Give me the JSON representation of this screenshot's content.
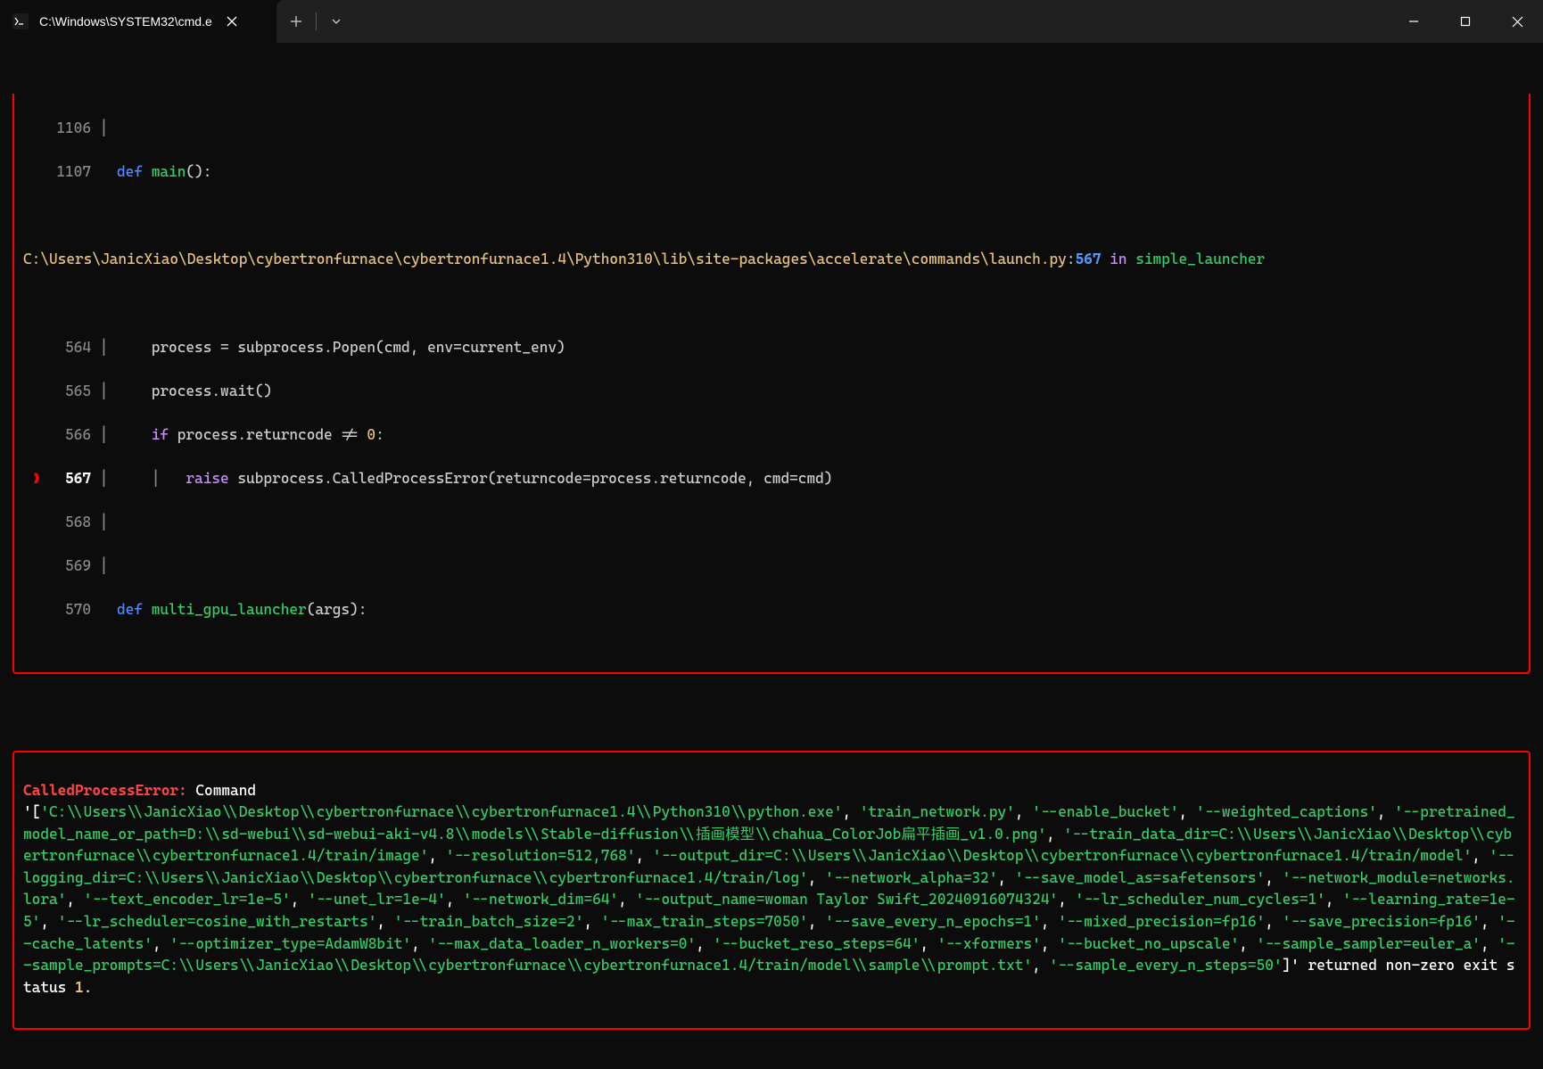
{
  "titlebar": {
    "tab_title": "C:\\Windows\\SYSTEM32\\cmd.e",
    "tab_icon": "cmd-icon",
    "close_icon": "×",
    "new_tab_icon": "+",
    "dropdown_icon": "⌄"
  },
  "window_controls": {
    "minimize": "—",
    "maximize": "□",
    "close": "✕"
  },
  "trace_top": {
    "ln1106": "1106",
    "ln1107": "1107",
    "ln1107_def": "def ",
    "ln1107_fn": "main",
    "ln1107_rest": "():",
    "path": "C:\\Users\\JanicXiao\\Desktop\\cybertronfurnace\\cybertronfurnace1.4\\Python310\\lib\\site-packages\\accelerate\\commands\\launch.py",
    "path_colon": ":",
    "path_line": "567",
    "path_in": " in ",
    "path_fn": "simple_launcher",
    "ln564": " 564",
    "ln564_code": "    process = subprocess.Popen(cmd, env=current_env)",
    "ln565": " 565",
    "ln565_code": "    process.wait()",
    "ln566": " 566",
    "ln566_if": "if",
    "ln566_cond": " process.returncode != ",
    "ln566_zero": "0",
    "ln566_colon": ":",
    "ln567": " 567",
    "ln567_raise": "raise",
    "ln567_rest": " subprocess.CalledProcessError(returncode=process.returncode, cmd=cmd)",
    "ln568": " 568",
    "ln569": " 569",
    "ln570": " 570",
    "ln570_def": "def ",
    "ln570_fn": "multi_gpu_launcher",
    "ln570_rest": "(args):",
    "marker": "❱"
  },
  "error": {
    "name": "CalledProcessError: ",
    "command_word": "Command",
    "open_bracket": "'[",
    "args": [
      "'C:\\\\Users\\\\JanicXiao\\\\Desktop\\\\cybertronfurnace\\\\cybertronfurnace1.4\\\\Python310\\\\python.exe'",
      "'train_network.py'",
      "'--enable_bucket'",
      "'--weighted_captions'",
      "'--pretrained_model_name_or_path=D:\\\\sd-webui\\\\sd-webui-aki-v4.8\\\\models\\\\Stable-diffusion\\\\插画模型\\\\chahua_ColorJob扁平插画_v1.0.png'",
      "'--train_data_dir=C:\\\\Users\\\\JanicXiao\\\\Desktop\\\\cybertronfurnace\\\\cybertronfurnace1.4/train/image'",
      "'--resolution=512,768'",
      "'--output_dir=C:\\\\Users\\\\JanicXiao\\\\Desktop\\\\cybertronfurnace\\\\cybertronfurnace1.4/train/model'",
      "'--logging_dir=C:\\\\Users\\\\JanicXiao\\\\Desktop\\\\cybertronfurnace\\\\cybertronfurnace1.4/train/log'",
      "'--network_alpha=32'",
      "'--save_model_as=safetensors'",
      "'--network_module=networks.lora'",
      "'--text_encoder_lr=1e-5'",
      "'--unet_lr=1e-4'",
      "'--network_dim=64'",
      "'--output_name=woman Taylor Swift_20240916074324'",
      "'--lr_scheduler_num_cycles=1'",
      "'--learning_rate=1e-5'",
      "'--lr_scheduler=cosine_with_restarts'",
      "'--train_batch_size=2'",
      "'--max_train_steps=7050'",
      "'--save_every_n_epochs=1'",
      "'--mixed_precision=fp16'",
      "'--save_precision=fp16'",
      "'--cache_latents'",
      "'--optimizer_type=AdamW8bit'",
      "'--max_data_loader_n_workers=0'",
      "'--bucket_reso_steps=64'",
      "'--xformers'",
      "'--bucket_no_upscale'",
      "'--sample_sampler=euler_a'",
      "'--sample_prompts=C:\\\\Users\\\\JanicXiao\\\\Desktop\\\\cybertronfurnace\\\\cybertronfurnace1.4/train/model\\\\sample\\\\prompt.txt'",
      "'--sample_every_n_steps=50'"
    ],
    "close_bracket": "]'",
    "returned_text": " returned non-zero exit status ",
    "exit_code": "1",
    "period": "."
  }
}
